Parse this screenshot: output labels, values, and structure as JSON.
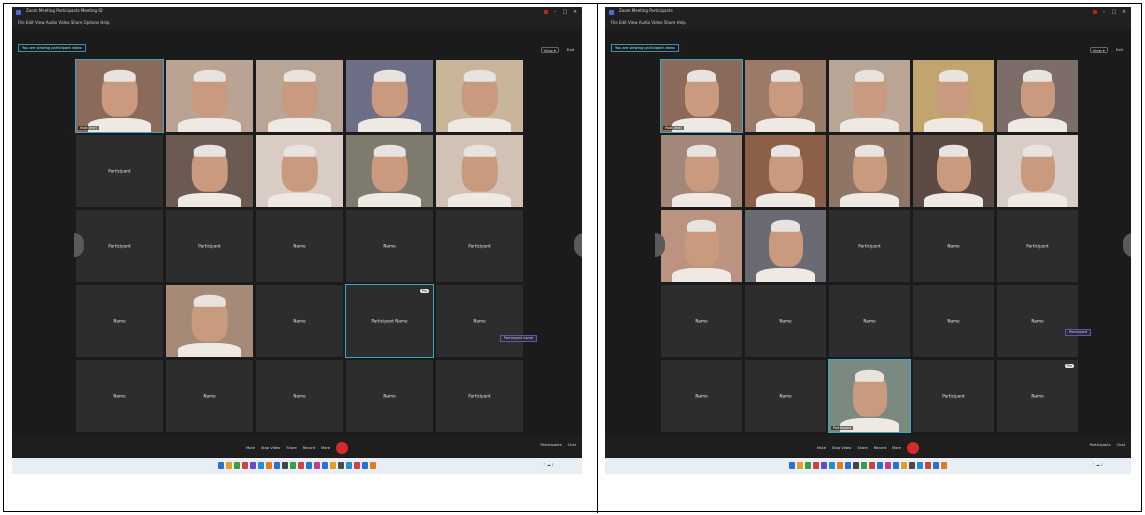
{
  "left": {
    "title": "Zoom Meeting  Participants  Meeting ID",
    "menu": "File  Edit  View  Audio  Video  Share  Options  Help",
    "share_tag": "You are viewing participant video",
    "view_buttons": [
      "View ▾",
      "Exit"
    ],
    "tiles": [
      {
        "kind": "cam",
        "caption": "Host (me)",
        "tone": "#8a6a5a",
        "active": true
      },
      {
        "kind": "cam",
        "caption": "",
        "tone": "#b9a392"
      },
      {
        "kind": "cam",
        "caption": "",
        "tone": "#b8a596"
      },
      {
        "kind": "cam",
        "caption": "",
        "tone": "#6c6f86"
      },
      {
        "kind": "cam",
        "caption": "",
        "tone": "#c9b69a"
      },
      {
        "kind": "name",
        "name": "Participant"
      },
      {
        "kind": "cam",
        "caption": "",
        "tone": "#6b5a52"
      },
      {
        "kind": "cam",
        "caption": "",
        "tone": "#d9ccc4"
      },
      {
        "kind": "cam",
        "caption": "",
        "tone": "#7f7a6e"
      },
      {
        "kind": "cam",
        "caption": "",
        "tone": "#d2c2b6"
      },
      {
        "kind": "name",
        "name": "Participant"
      },
      {
        "kind": "name",
        "name": "Participant"
      },
      {
        "kind": "name",
        "name": "Name"
      },
      {
        "kind": "name",
        "name": "Name"
      },
      {
        "kind": "name",
        "name": "Participant"
      },
      {
        "kind": "name",
        "name": "Name"
      },
      {
        "kind": "cam",
        "caption": "",
        "tone": "#a68a78"
      },
      {
        "kind": "name",
        "name": "Name"
      },
      {
        "kind": "name",
        "name": "Participant Name",
        "active": true,
        "pin": "Pin"
      },
      {
        "kind": "name",
        "name": "Name"
      },
      {
        "kind": "name",
        "name": "Name"
      },
      {
        "kind": "name",
        "name": "Name"
      },
      {
        "kind": "name",
        "name": "Name"
      },
      {
        "kind": "name",
        "name": "Name"
      },
      {
        "kind": "name",
        "name": "Participant"
      }
    ],
    "floating_label": "Participant name",
    "controls": [
      "Mute",
      "Stop Video",
      "Share",
      "Record",
      "More"
    ],
    "controls_right": [
      "Participants",
      "Chat"
    ],
    "clock": [
      "",
      ""
    ]
  },
  "right": {
    "title": "Zoom Meeting  Participants",
    "menu": "File  Edit  View  Audio  Video  Share  Help",
    "share_tag": "You are viewing participant video",
    "view_buttons": [
      "View ▾",
      "Exit"
    ],
    "tiles": [
      {
        "kind": "cam",
        "caption": "Host (me)",
        "tone": "#8a6a5a",
        "active": true
      },
      {
        "kind": "cam",
        "caption": "",
        "tone": "#9b7a68"
      },
      {
        "kind": "cam",
        "caption": "",
        "tone": "#b8a596"
      },
      {
        "kind": "cam",
        "caption": "",
        "tone": "#c2a46e"
      },
      {
        "kind": "cam",
        "caption": "",
        "tone": "#7c6d68"
      },
      {
        "kind": "cam",
        "caption": "",
        "tone": "#a2877a"
      },
      {
        "kind": "cam",
        "caption": "",
        "tone": "#8c6048"
      },
      {
        "kind": "cam",
        "caption": "",
        "tone": "#8e7566"
      },
      {
        "kind": "cam",
        "caption": "",
        "tone": "#5c4a44"
      },
      {
        "kind": "cam",
        "caption": "",
        "tone": "#d8cdc6"
      },
      {
        "kind": "cam",
        "caption": "",
        "tone": "#bb9380"
      },
      {
        "kind": "cam",
        "caption": "",
        "tone": "#6a6a72"
      },
      {
        "kind": "name",
        "name": "Participant"
      },
      {
        "kind": "name",
        "name": "Name"
      },
      {
        "kind": "name",
        "name": "Participant"
      },
      {
        "kind": "name",
        "name": "Name"
      },
      {
        "kind": "name",
        "name": "Name"
      },
      {
        "kind": "name",
        "name": "Name"
      },
      {
        "kind": "name",
        "name": "Name"
      },
      {
        "kind": "name",
        "name": "Name"
      },
      {
        "kind": "name",
        "name": "Name"
      },
      {
        "kind": "name",
        "name": "Name"
      },
      {
        "kind": "cam",
        "caption": "Participant",
        "tone": "#7b8a80",
        "active": true
      },
      {
        "kind": "name",
        "name": "Participant"
      },
      {
        "kind": "name",
        "name": "Name",
        "pin": "Pin"
      }
    ],
    "floating_label": "Participant",
    "controls": [
      "Mute",
      "Stop Video",
      "Share",
      "Record",
      "More"
    ],
    "controls_right": [
      "Participants",
      "Chat"
    ],
    "clock": [
      "",
      ""
    ]
  },
  "colors": {
    "accent": "#3aa6c8",
    "end_button": "#d42a2a",
    "tile": "#2d2d2d",
    "window": "#1b1b1b",
    "taskbar": "#e9eef5"
  }
}
